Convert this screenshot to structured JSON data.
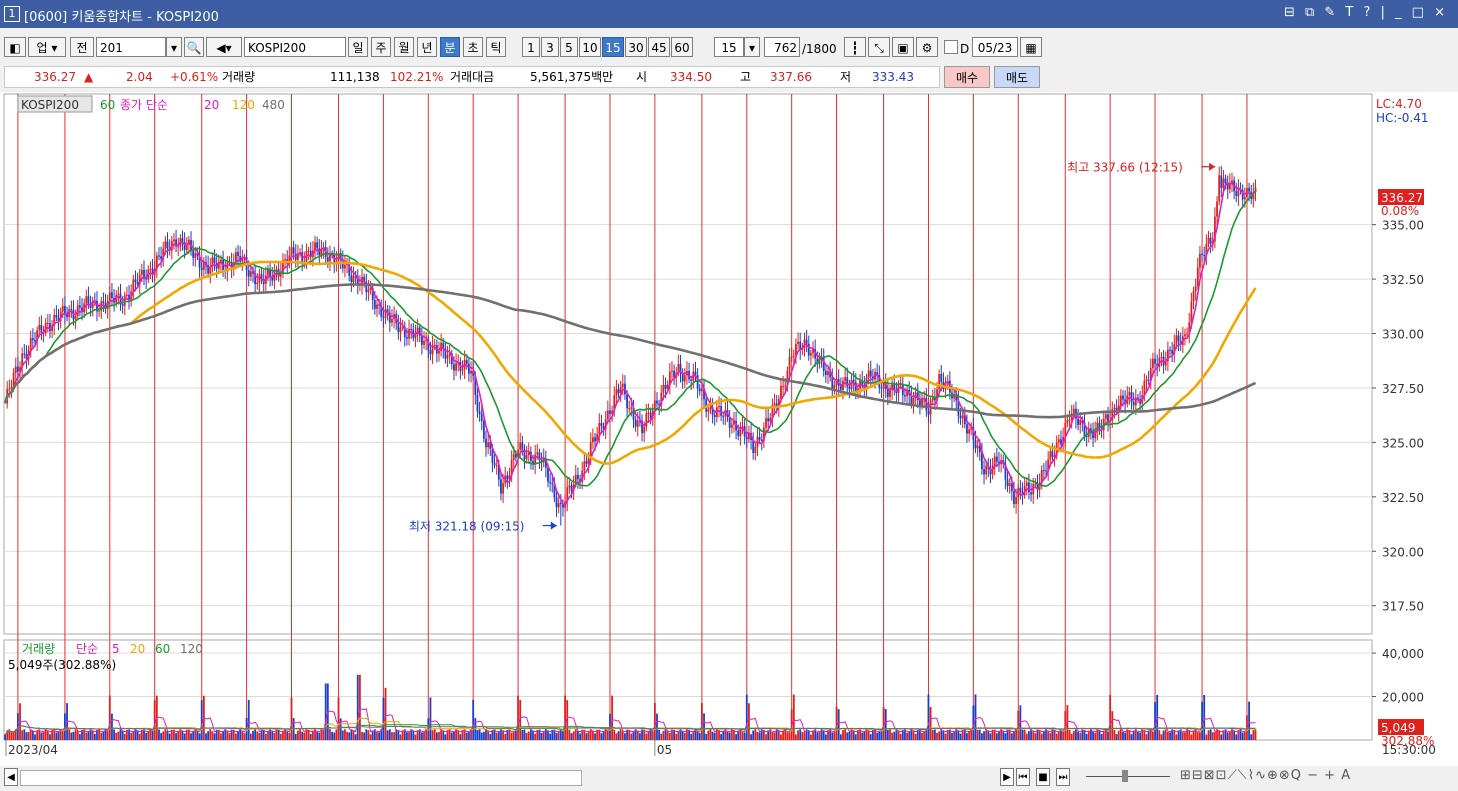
{
  "window": {
    "num": "1",
    "title": "[0600] 키움종합차트 - KOSPI200",
    "controls": "⊟ ⧉ ✎ T ? | _ □ ×"
  },
  "toolbar": {
    "market": "업",
    "prev": "전",
    "code": "201",
    "name": "KOSPI200",
    "periods": [
      "일",
      "주",
      "월",
      "년",
      "분",
      "초",
      "틱"
    ],
    "period_selected": "분",
    "intervals": [
      "1",
      "3",
      "5",
      "10",
      "15",
      "30",
      "45",
      "60"
    ],
    "interval_selected": "15",
    "interval_value": "15",
    "count": "762",
    "count_max": "/1800",
    "d_label": "D",
    "date": "05/23"
  },
  "quote": {
    "price": "336.27",
    "arrow": "▲",
    "change": "2.04",
    "change_pct": "+0.61%",
    "vol_label": "거래량",
    "vol": "111,138",
    "vol_pct": "102.21%",
    "amt_label": "거래대금",
    "amt": "5,561,375백만",
    "open_label": "시",
    "open": "334.50",
    "high_label": "고",
    "high": "337.66",
    "low_label": "저",
    "low": "333.43",
    "buy": "매수",
    "sell": "매도"
  },
  "colors": {
    "up": "#e0201a",
    "down": "#1c3ec8",
    "ma5": "#e020b8",
    "ma20": "#1a9a30",
    "ma60": "#f0a800",
    "ma120": "#707070",
    "vline": "#e03030"
  },
  "chart_data": [
    {
      "type": "candlestick",
      "legend": {
        "symbol": "KOSPI200",
        "ma60": "60",
        "label": "종가 단순",
        "ma20": "20",
        "ma120": "120",
        "ma480": "480"
      },
      "ylim": [
        316.2,
        341.0
      ],
      "y_ticks": [
        "335.00",
        "332.50",
        "330.00",
        "327.50",
        "325.00",
        "322.50",
        "320.00",
        "317.50"
      ],
      "y_tick_values": [
        335,
        332.5,
        330,
        327.5,
        325,
        322.5,
        320,
        317.5
      ],
      "x_labels": [
        "2023/04",
        "05"
      ],
      "x_label_bar_index": [
        0,
        304
      ],
      "time_label": "15:30:00",
      "n_bars": 600,
      "lc": "LC:4.70",
      "hc": "HC:-0.41",
      "current_value": "336.27",
      "current_pct": "0.08%",
      "current_value_num": 336.27,
      "max_label": "최고 337.66 (12:15)",
      "max_value": 337.66,
      "max_bar_index": 568,
      "min_label": "최저 321.18 (09:15)",
      "min_value": 321.18,
      "min_bar_index": 260,
      "day_separator_bar_index": [
        6,
        28,
        49,
        70,
        92,
        113,
        134,
        156,
        177,
        198,
        219,
        240,
        262,
        283,
        304,
        326,
        347,
        368,
        389,
        411,
        432,
        453,
        474,
        496,
        517,
        538,
        560,
        581
      ],
      "key_closes": [
        [
          0,
          326.8
        ],
        [
          8,
          329.0
        ],
        [
          20,
          330.5
        ],
        [
          35,
          331.2
        ],
        [
          55,
          331.6
        ],
        [
          70,
          333.2
        ],
        [
          80,
          334.4
        ],
        [
          95,
          333.0
        ],
        [
          110,
          333.4
        ],
        [
          120,
          332.3
        ],
        [
          135,
          333.6
        ],
        [
          150,
          333.8
        ],
        [
          165,
          332.5
        ],
        [
          180,
          330.6
        ],
        [
          200,
          329.4
        ],
        [
          218,
          328.2
        ],
        [
          225,
          325.0
        ],
        [
          232,
          323.0
        ],
        [
          240,
          324.6
        ],
        [
          250,
          324.3
        ],
        [
          260,
          322.0
        ],
        [
          270,
          323.8
        ],
        [
          280,
          326.0
        ],
        [
          288,
          327.5
        ],
        [
          298,
          325.5
        ],
        [
          305,
          327.0
        ],
        [
          315,
          328.4
        ],
        [
          322,
          327.9
        ],
        [
          330,
          326.5
        ],
        [
          340,
          326.0
        ],
        [
          350,
          324.8
        ],
        [
          360,
          326.5
        ],
        [
          368,
          329.0
        ],
        [
          375,
          329.6
        ],
        [
          385,
          328.0
        ],
        [
          395,
          327.5
        ],
        [
          405,
          328.0
        ],
        [
          415,
          327.4
        ],
        [
          425,
          327.2
        ],
        [
          432,
          326.4
        ],
        [
          437,
          328.0
        ],
        [
          445,
          326.8
        ],
        [
          452,
          325.3
        ],
        [
          458,
          323.8
        ],
        [
          465,
          324.1
        ],
        [
          472,
          322.6
        ],
        [
          480,
          322.8
        ],
        [
          490,
          324.3
        ],
        [
          498,
          326.3
        ],
        [
          505,
          325.6
        ],
        [
          512,
          325.5
        ],
        [
          520,
          326.8
        ],
        [
          530,
          327.0
        ],
        [
          538,
          328.6
        ],
        [
          545,
          329.2
        ],
        [
          552,
          329.8
        ],
        [
          558,
          333.0
        ],
        [
          565,
          334.6
        ],
        [
          568,
          336.8
        ],
        [
          573,
          336.7
        ],
        [
          578,
          336.6
        ],
        [
          583,
          336.3
        ],
        [
          585,
          336.27
        ]
      ],
      "series": [
        {
          "name": "종가 단순 20",
          "values_ref": "key_closes",
          "period": 20
        },
        {
          "name": "60",
          "values_ref": "key_closes",
          "period": 60
        },
        {
          "name": "120",
          "values_ref": "key_closes",
          "period": 120
        },
        {
          "name": "480",
          "values_ref": "key_closes",
          "period": 480
        }
      ]
    },
    {
      "type": "bar",
      "legend": {
        "label": "거래량",
        "ma_label": "단순",
        "ma5": "5",
        "ma20": "20",
        "ma60": "60",
        "ma120": "120"
      },
      "volume_text": "5,049주(302.88%)",
      "ylim": [
        0,
        46000
      ],
      "y_ticks": [
        "40,000",
        "20,000"
      ],
      "y_tick_values": [
        40000,
        20000
      ],
      "current_value": "5,049",
      "current_pct": "302.88%",
      "current_value_num": 5049
    }
  ]
}
